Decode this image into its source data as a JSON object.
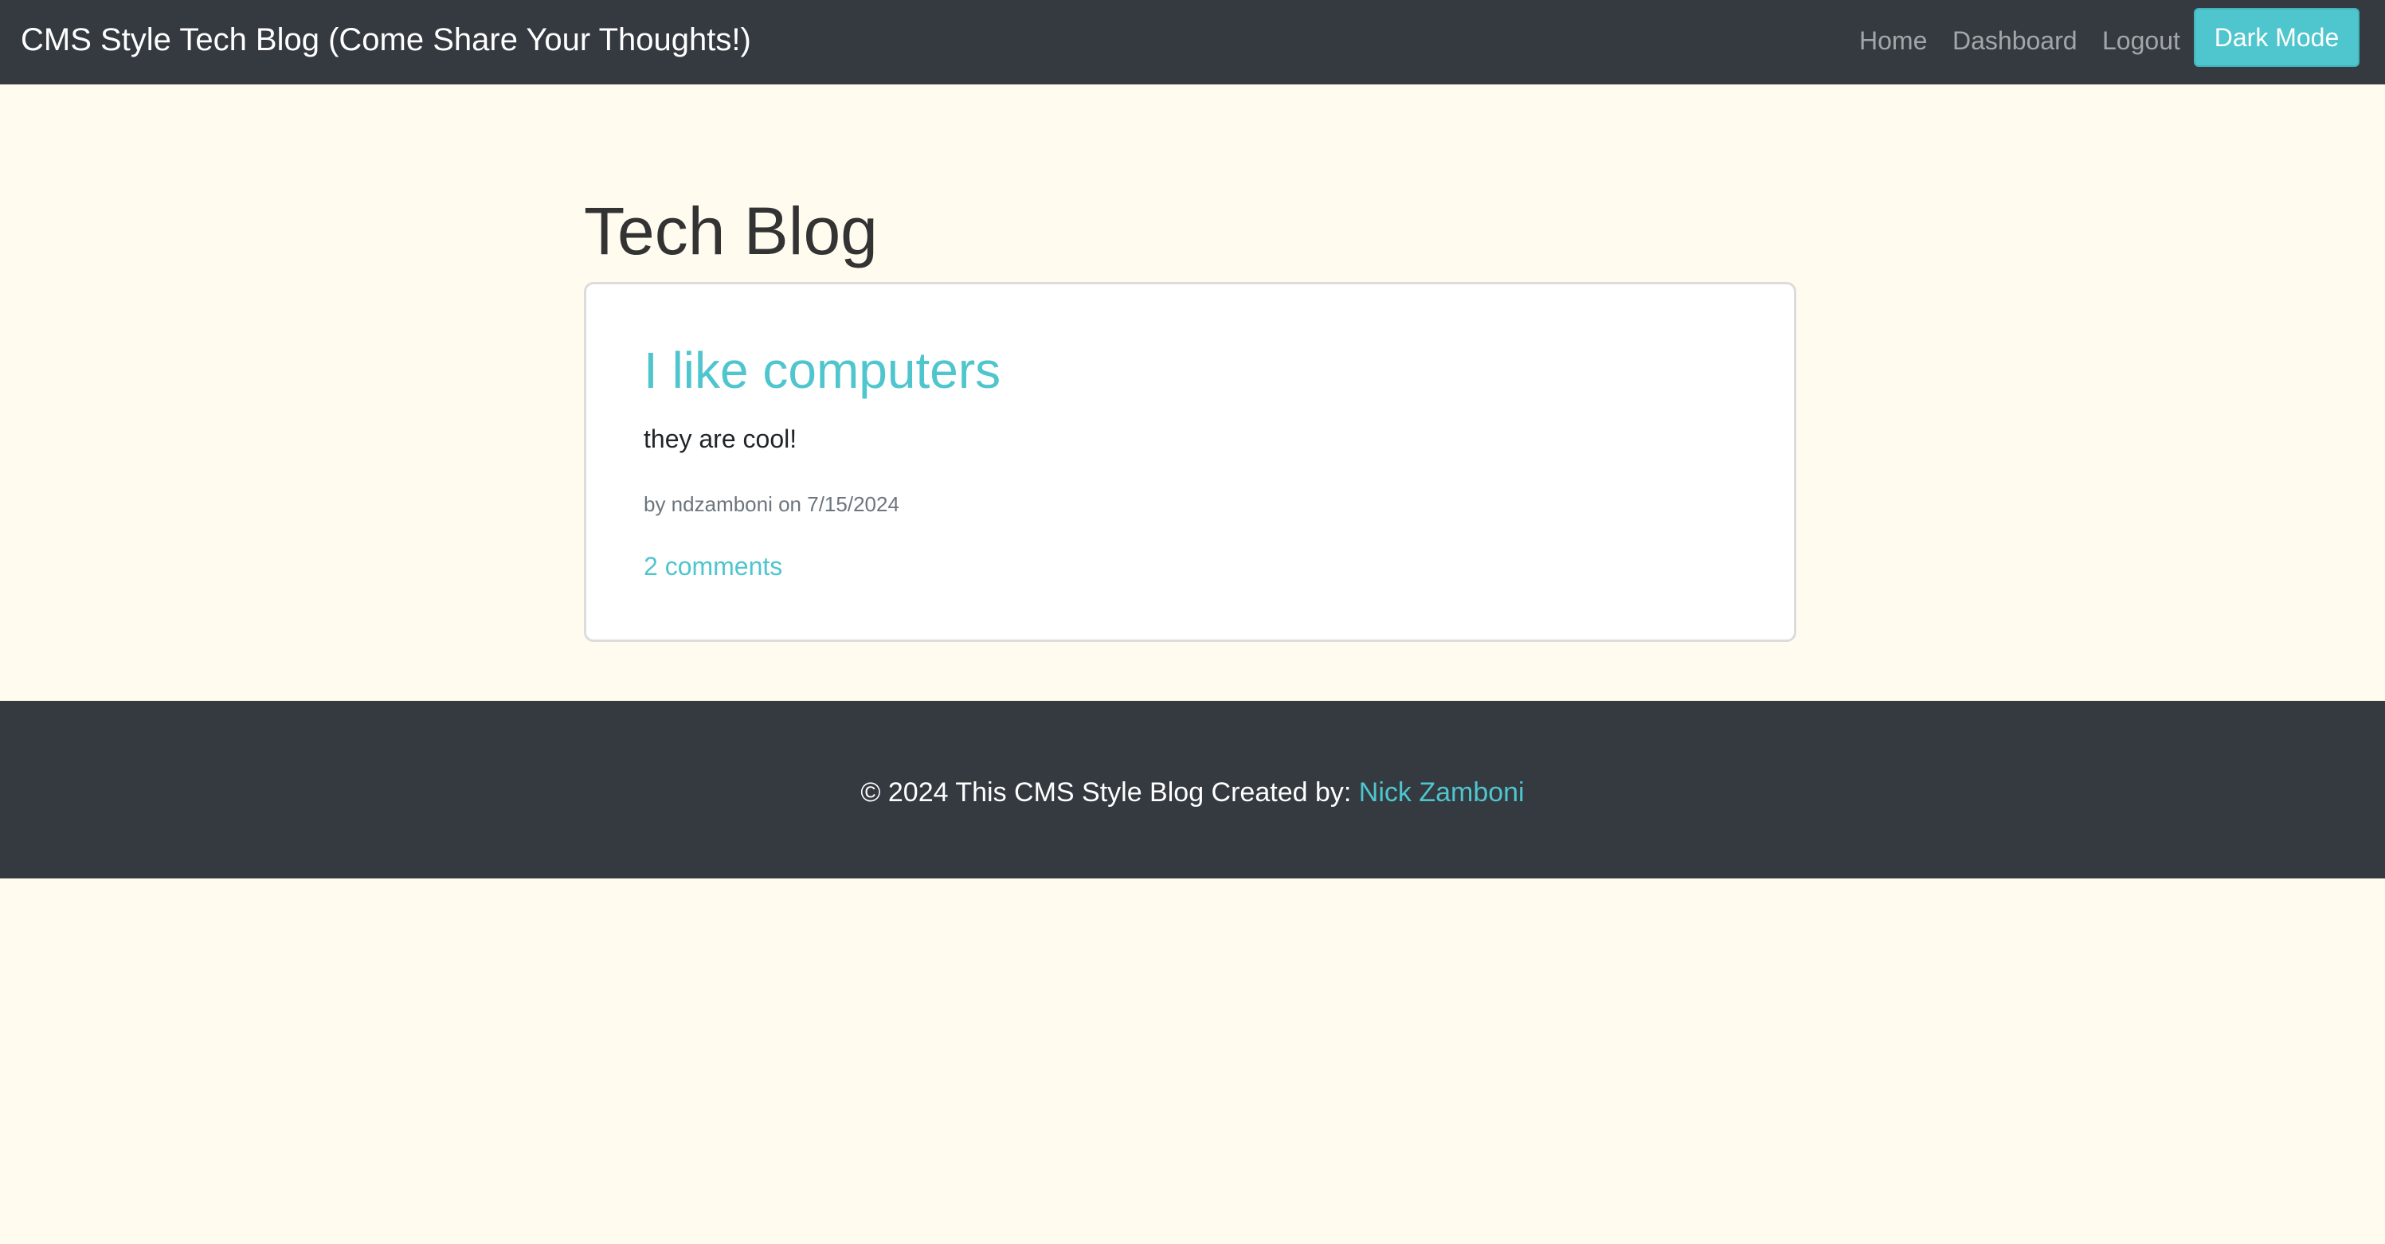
{
  "navbar": {
    "brand": "CMS Style Tech Blog (Come Share Your Thoughts!)",
    "links": [
      "Home",
      "Dashboard",
      "Logout"
    ],
    "dark_mode_label": "Dark Mode"
  },
  "main": {
    "title": "Tech Blog",
    "posts": [
      {
        "title": "I like computers",
        "body": "they are cool!",
        "meta": "by ndzamboni on 7/15/2024",
        "comments": "2 comments"
      }
    ]
  },
  "footer": {
    "text": "© 2024 This CMS Style Blog Created by: ",
    "author": "Nick Zamboni"
  },
  "colors": {
    "navbar_bg": "#343a40",
    "page_bg": "#fffcef",
    "accent": "#4fc5cd"
  }
}
